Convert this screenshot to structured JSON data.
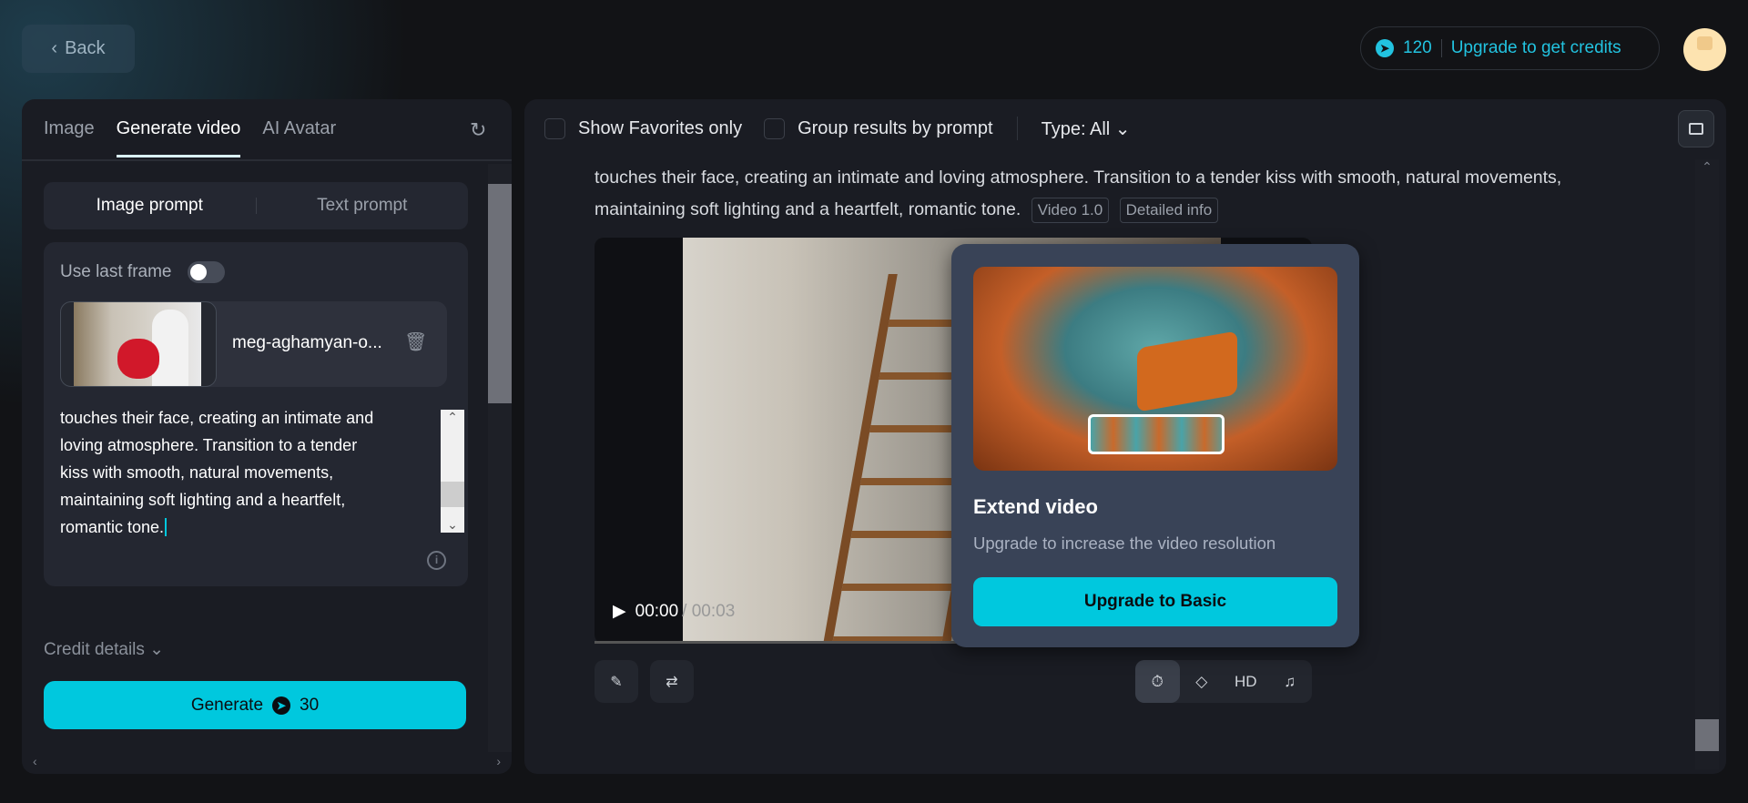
{
  "header": {
    "back_label": "Back",
    "credits": "120",
    "upgrade_label": "Upgrade to get credits"
  },
  "left": {
    "tabs": [
      "Image",
      "Generate video",
      "AI Avatar"
    ],
    "prompt_modes": [
      "Image prompt",
      "Text prompt"
    ],
    "use_last_frame_label": "Use last frame",
    "use_last_frame_on": false,
    "file_name": "meg-aghamyan-o...",
    "prompt_lines": [
      "touches their face, creating an intimate and",
      "loving atmosphere. Transition to a tender",
      "kiss with smooth, natural movements,",
      "maintaining soft lighting and a heartfelt,",
      "romantic tone."
    ],
    "credit_details_label": "Credit details",
    "generate_label": "Generate",
    "generate_cost": "30"
  },
  "right": {
    "show_favorites_label": "Show Favorites only",
    "group_results_label": "Group results by prompt",
    "type_label": "Type: All",
    "prompt_text": "touches their face, creating an intimate and loving atmosphere. Transition to a tender kiss with smooth, natural movements, maintaining soft lighting and a heartfelt, romantic tone.",
    "model_tag": "Video 1.0",
    "detail_tag": "Detailed info",
    "time_current": "00:00",
    "time_total": "/ 00:03",
    "hd_label": "HD"
  },
  "popup": {
    "title": "Extend video",
    "subtitle": "Upgrade to increase the video resolution",
    "button": "Upgrade to Basic"
  },
  "colors": {
    "accent": "#00c8de",
    "bg": "#121316",
    "panel": "#1a1c23",
    "popup": "#394357"
  }
}
